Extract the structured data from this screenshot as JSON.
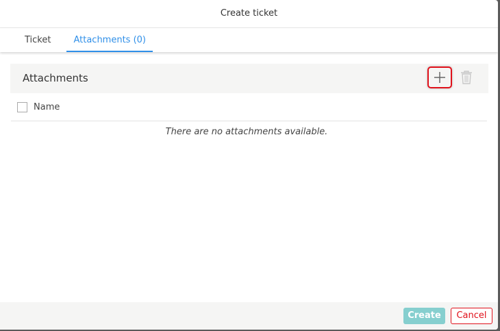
{
  "dialog": {
    "title": "Create ticket"
  },
  "tabs": [
    {
      "label": "Ticket",
      "active": false
    },
    {
      "label": "Attachments (0)",
      "active": true
    }
  ],
  "attachments": {
    "title": "Attachments",
    "add_icon": "plus-icon",
    "delete_icon": "trash-icon",
    "columns": [
      "Name"
    ],
    "empty_text": "There are no attachments available."
  },
  "footer": {
    "create_label": "Create",
    "cancel_label": "Cancel"
  },
  "colors": {
    "accent": "#2f8fe8",
    "create": "#86cfcf",
    "danger": "#e0101a"
  }
}
